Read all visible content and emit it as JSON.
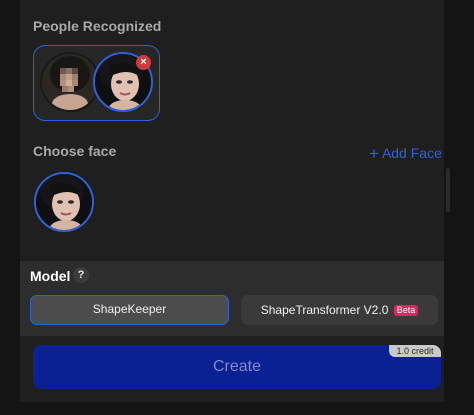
{
  "sections": {
    "people_title": "People Recognized",
    "choose_title": "Choose face",
    "add_face_label": "Add Face"
  },
  "model": {
    "title": "Model",
    "help_symbol": "?",
    "options": [
      {
        "label": "ShapeKeeper",
        "selected": true
      },
      {
        "label": "ShapeTransformer V2.0",
        "badge": "Beta",
        "selected": false
      }
    ]
  },
  "actions": {
    "create_label": "Create",
    "credit_label": "1.0 credit"
  },
  "icons": {
    "remove": "close-icon",
    "add": "plus-icon",
    "help": "question-icon"
  },
  "colors": {
    "accent": "#2d63d8",
    "create_bg": "#0a2093",
    "remove_badge": "#cf3b3b",
    "beta_badge": "#e0245e"
  }
}
